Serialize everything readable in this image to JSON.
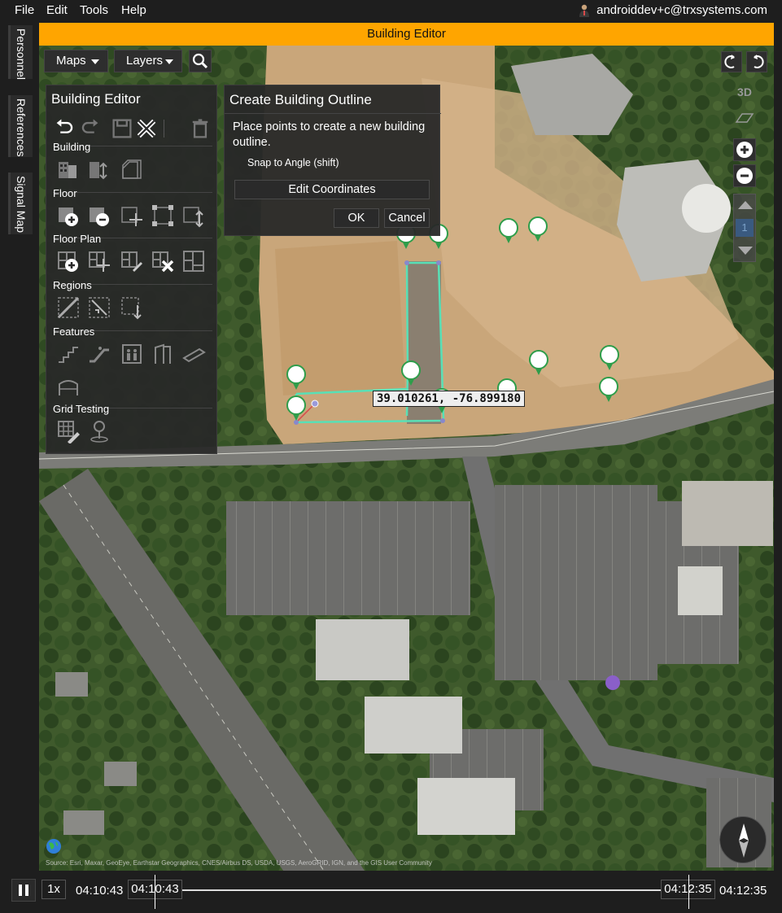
{
  "menu": {
    "file": "File",
    "edit": "Edit",
    "tools": "Tools",
    "help": "Help",
    "user": "androiddev+c@trxsystems.com"
  },
  "side_tabs": [
    "Personnel",
    "References",
    "Signal Map"
  ],
  "window_title": "Building Editor",
  "map_toolbar": {
    "maps": "Maps",
    "layers": "Layers"
  },
  "editor": {
    "title": "Building Editor",
    "sections": {
      "building": "Building",
      "floor": "Floor",
      "floor_plan": "Floor Plan",
      "regions": "Regions",
      "features": "Features",
      "grid_testing": "Grid Testing"
    }
  },
  "dialog": {
    "title": "Create Building Outline",
    "description": "Place points to create a new building outline.",
    "snap": "Snap to Angle (shift)",
    "edit_coords": "Edit Coordinates",
    "ok": "OK",
    "cancel": "Cancel"
  },
  "map_controls": {
    "mode_3d": "3D",
    "floor_number": "1"
  },
  "coordinate_readout": "39.010261, -76.899180",
  "attribution": "Source: Esri, Maxar, GeoEye, Earthstar Geographics, CNES/Airbus DS, USDA, USGS, AeroGRID, IGN, and the GIS User Community",
  "playback": {
    "speed": "1x",
    "start_time": "04:10:43",
    "range_start": "04:10:43",
    "range_end": "04:12:35",
    "end_time": "04:12:35"
  },
  "colors": {
    "accent": "#ffa500",
    "outline": "#58e0b6",
    "pin": "#2e9d4a"
  }
}
